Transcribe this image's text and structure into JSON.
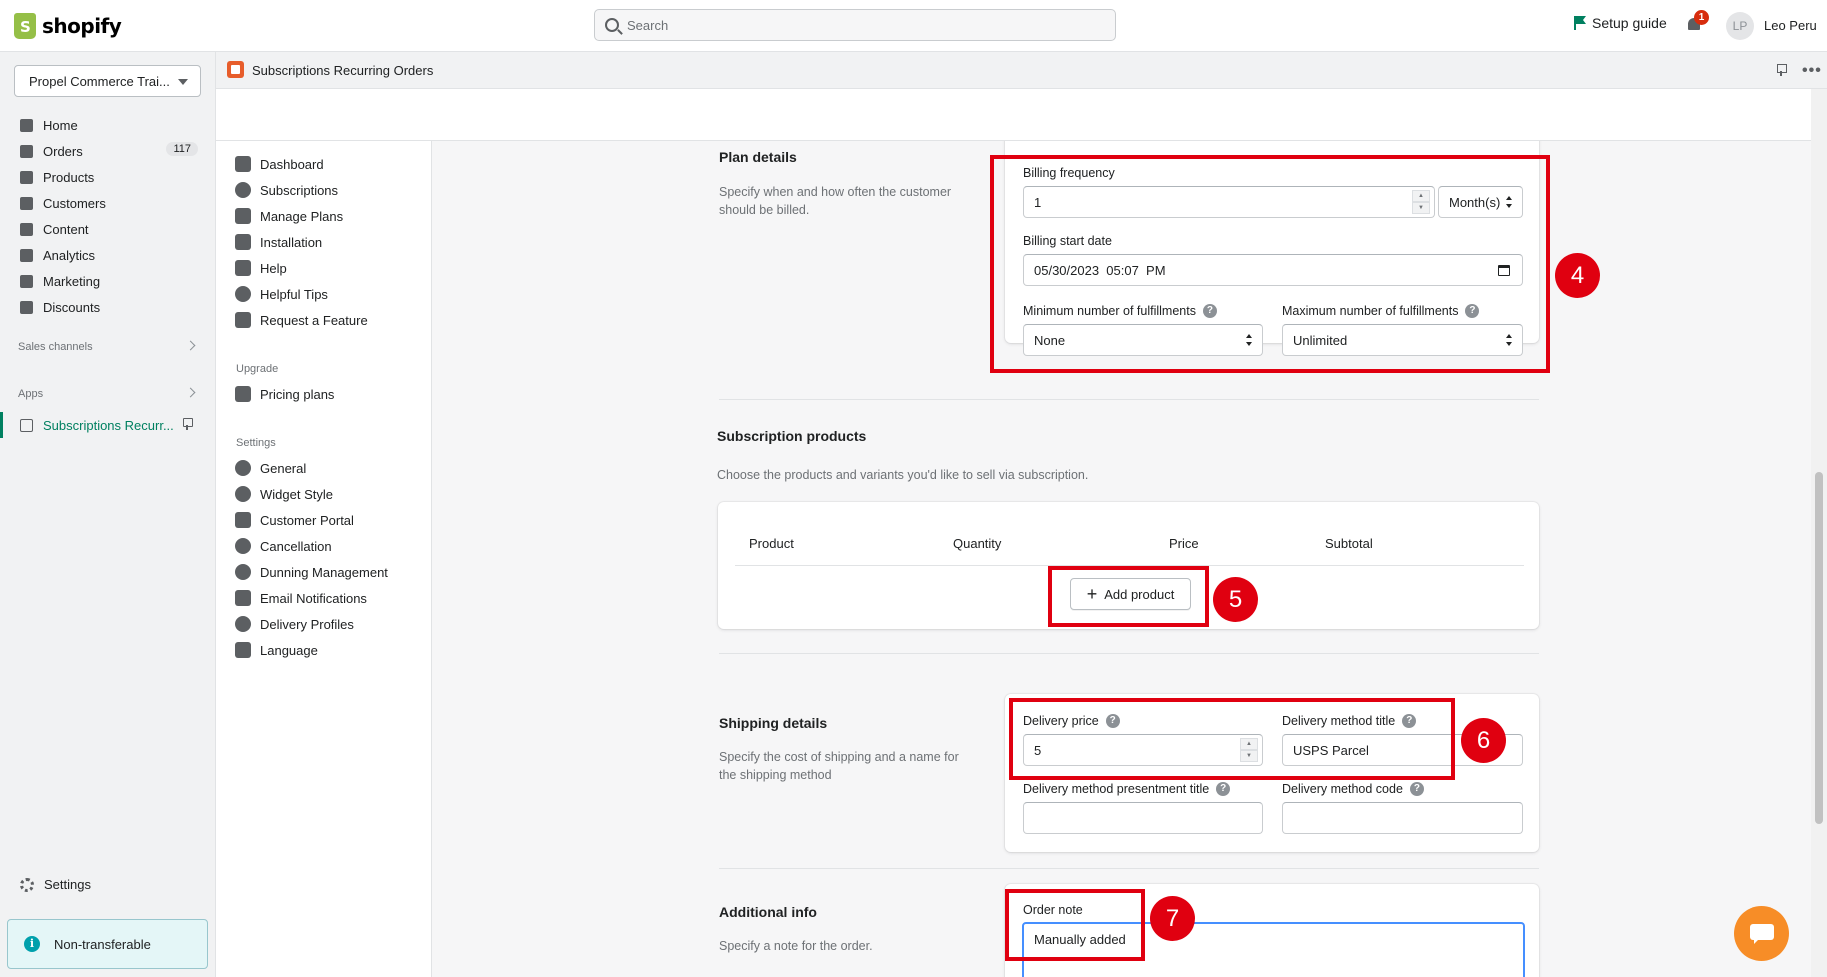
{
  "topbar": {
    "logo_text": "shopify",
    "search_placeholder": "Search",
    "setup_guide": "Setup guide",
    "notification_count": "1",
    "avatar_initials": "LP",
    "user_name": "Leo Peru"
  },
  "sidebar": {
    "store_name": "Propel Commerce Trai...",
    "items": [
      {
        "label": "Home",
        "icon": "home-icon"
      },
      {
        "label": "Orders",
        "icon": "orders-icon",
        "badge": "117"
      },
      {
        "label": "Products",
        "icon": "tag-icon"
      },
      {
        "label": "Customers",
        "icon": "person-icon"
      },
      {
        "label": "Content",
        "icon": "content-icon"
      },
      {
        "label": "Analytics",
        "icon": "analytics-icon"
      },
      {
        "label": "Marketing",
        "icon": "target-icon"
      },
      {
        "label": "Discounts",
        "icon": "discount-icon"
      }
    ],
    "sales_channels": "Sales channels",
    "apps": "Apps",
    "active_app": "Subscriptions Recurr...",
    "settings": "Settings",
    "non_transferable": "Non-transferable"
  },
  "app_header": {
    "title": "Subscriptions Recurring Orders"
  },
  "app_nav": {
    "main": [
      "Dashboard",
      "Subscriptions",
      "Manage Plans",
      "Installation",
      "Help",
      "Helpful Tips",
      "Request a Feature"
    ],
    "upgrade_heading": "Upgrade",
    "upgrade": [
      "Pricing plans"
    ],
    "settings_heading": "Settings",
    "settings": [
      "General",
      "Widget Style",
      "Customer Portal",
      "Cancellation",
      "Dunning Management",
      "Email Notifications",
      "Delivery Profiles",
      "Language"
    ]
  },
  "plan_details": {
    "title": "Plan details",
    "description": "Specify when and how often the customer should be billed.",
    "billing_frequency_label": "Billing frequency",
    "billing_frequency_value": "1",
    "billing_unit": "Month(s)",
    "billing_start_label": "Billing start date",
    "billing_start_value": "05/30/2023  05:07  PM",
    "min_fulfillments_label": "Minimum number of fulfillments",
    "min_fulfillments_value": "None",
    "max_fulfillments_label": "Maximum number of fulfillments",
    "max_fulfillments_value": "Unlimited"
  },
  "subscription_products": {
    "title": "Subscription products",
    "description": "Choose the products and variants you'd like to sell via subscription.",
    "columns": [
      "Product",
      "Quantity",
      "Price",
      "Subtotal"
    ],
    "add_product": "Add product"
  },
  "shipping_details": {
    "title": "Shipping details",
    "description": "Specify the cost of shipping and a name for the shipping method",
    "delivery_price_label": "Delivery price",
    "delivery_price_value": "5",
    "delivery_method_title_label": "Delivery method title",
    "delivery_method_title_value": "USPS Parcel",
    "presentment_title_label": "Delivery method presentment title",
    "presentment_title_value": "",
    "method_code_label": "Delivery method code",
    "method_code_value": ""
  },
  "additional_info": {
    "title": "Additional info",
    "description": "Specify a note for the order.",
    "order_note_label": "Order note",
    "order_note_value": "Manually added"
  },
  "annotations": [
    "4",
    "5",
    "6",
    "7"
  ],
  "colors": {
    "annotation_red": "#e00010",
    "shopify_green": "#008060",
    "chat_orange": "#f78d27"
  }
}
